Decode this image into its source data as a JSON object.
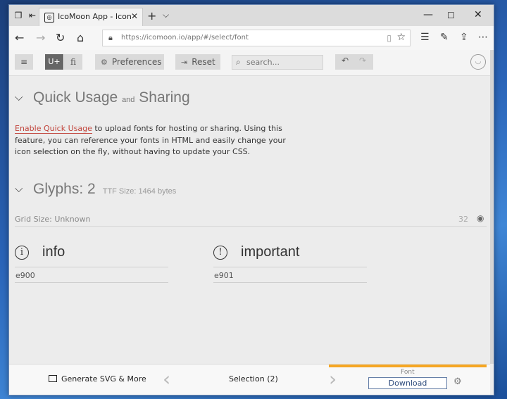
{
  "browser": {
    "tab_title": "IcoMoon App - Icon Font",
    "url_host": "https://icomoon.io",
    "url_path": "/app/#/select/font"
  },
  "toolbar": {
    "fonts_mode_label": "U+",
    "ligature_mode_label": "fi",
    "preferences_label": "Preferences",
    "reset_label": "Reset",
    "search_placeholder": "search..."
  },
  "quick_usage": {
    "title_part1": "Quick Usage",
    "title_and": "and",
    "title_part2": "Sharing",
    "link_text": "Enable Quick Usage",
    "body_text": " to upload fonts for hosting or sharing. Using this feature, you can reference your fonts in HTML and easily change your icon selection on the fly, without having to update your CSS."
  },
  "glyphs_section": {
    "title": "Glyphs: 2",
    "ttf_size": "TTF Size: 1464 bytes",
    "grid_size": "Grid Size: Unknown",
    "grid_value": "32",
    "glyphs": [
      {
        "name": "info",
        "code": "e900",
        "icon": "info-icon"
      },
      {
        "name": "important",
        "code": "e901",
        "icon": "exclamation-icon"
      }
    ]
  },
  "bottom_bar": {
    "generate_label": "Generate SVG & More",
    "selection_label": "Selection (2)",
    "font_label": "Font",
    "download_label": "Download"
  },
  "colors": {
    "accent_orange": "#f5a623",
    "link_red": "#c1433a",
    "download_border": "#667fa8"
  }
}
